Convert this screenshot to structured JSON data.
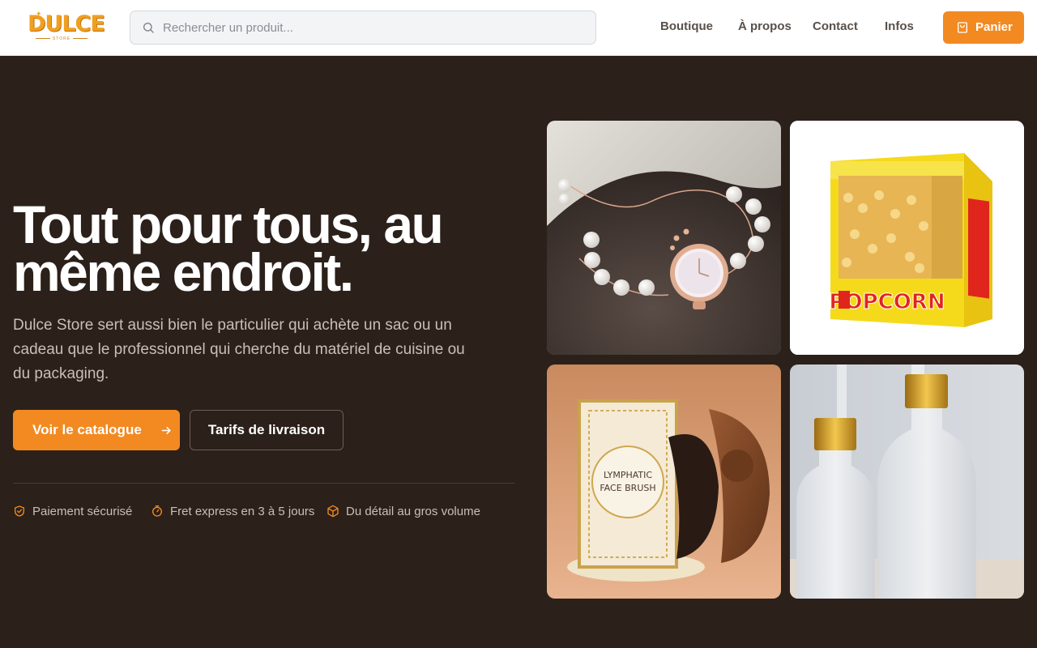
{
  "logo": {
    "brand": "DULCE",
    "sub": "STORE"
  },
  "search": {
    "placeholder": "Rechercher un produit..."
  },
  "nav": [
    "Boutique",
    "À propos",
    "Contact",
    "Infos"
  ],
  "cart": {
    "label": "Panier",
    "icon": "shopping-bag-icon"
  },
  "hero": {
    "title": "Tout pour tous, au même endroit.",
    "description": "Dulce Store sert aussi bien le particulier qui achète un sac ou un cadeau que le professionnel qui cherche du matériel de cuisine ou du packaging.",
    "primary_button": "Voir le catalogue",
    "secondary_button": "Tarifs de livraison"
  },
  "features": [
    {
      "icon": "shield-check-icon",
      "text": "Paiement sécurisé"
    },
    {
      "icon": "timer-icon",
      "text": "Fret express en 3 à 5 jours"
    },
    {
      "icon": "box-icon",
      "text": "Du détail au gros volume"
    }
  ],
  "products": {
    "popcorn_text": "POPCORN",
    "brush_text_1": "LYMPHATIC",
    "brush_text_2": "FACE BRUSH"
  },
  "colors": {
    "accent": "#f28a21",
    "background": "#2b201a",
    "header": "#ffffff"
  }
}
